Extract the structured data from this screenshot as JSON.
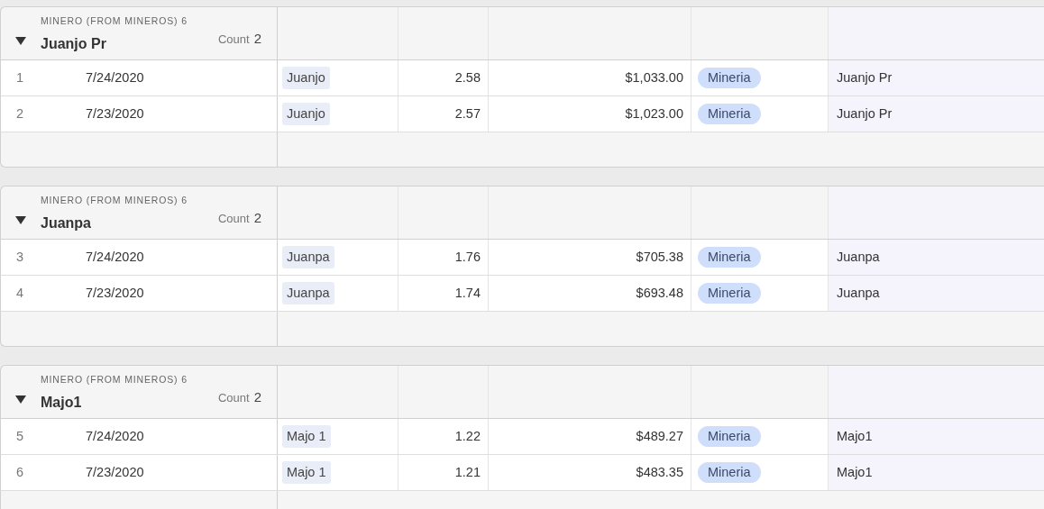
{
  "groups": [
    {
      "label": "MINERO (FROM MINEROS) 6",
      "name": "Juanjo Pr",
      "count_label": "Count",
      "count": "2",
      "expanded": true,
      "rows": [
        {
          "number": "1",
          "date": "7/24/2020",
          "column_3": "Juanjo",
          "column_4": "2.58",
          "column_5": "$1,033.00",
          "column_6": "Mineria",
          "column_7": "Juanjo Pr"
        },
        {
          "number": "2",
          "date": "7/23/2020",
          "column_3": "Juanjo",
          "column_4": "2.57",
          "column_5": "$1,023.00",
          "column_6": "Mineria",
          "column_7": "Juanjo Pr"
        }
      ]
    },
    {
      "label": "MINERO (FROM MINEROS) 6",
      "name": "Juanpa",
      "count_label": "Count",
      "count": "2",
      "expanded": true,
      "rows": [
        {
          "number": "3",
          "date": "7/24/2020",
          "column_3": "Juanpa",
          "column_4": "1.76",
          "column_5": "$705.38",
          "column_6": "Mineria",
          "column_7": "Juanpa"
        },
        {
          "number": "4",
          "date": "7/23/2020",
          "column_3": "Juanpa",
          "column_4": "1.74",
          "column_5": "$693.48",
          "column_6": "Mineria",
          "column_7": "Juanpa"
        }
      ]
    },
    {
      "label": "MINERO (FROM MINEROS) 6",
      "name": "Majo1",
      "count_label": "Count",
      "count": "2",
      "expanded": true,
      "rows": [
        {
          "number": "5",
          "date": "7/24/2020",
          "column_3": "Majo 1",
          "column_4": "1.22",
          "column_5": "$489.27",
          "column_6": "Mineria",
          "column_7": "Majo1"
        },
        {
          "number": "6",
          "date": "7/23/2020",
          "column_3": "Majo 1",
          "column_4": "1.21",
          "column_5": "$483.35",
          "column_6": "Mineria",
          "column_7": "Majo1"
        }
      ]
    }
  ]
}
